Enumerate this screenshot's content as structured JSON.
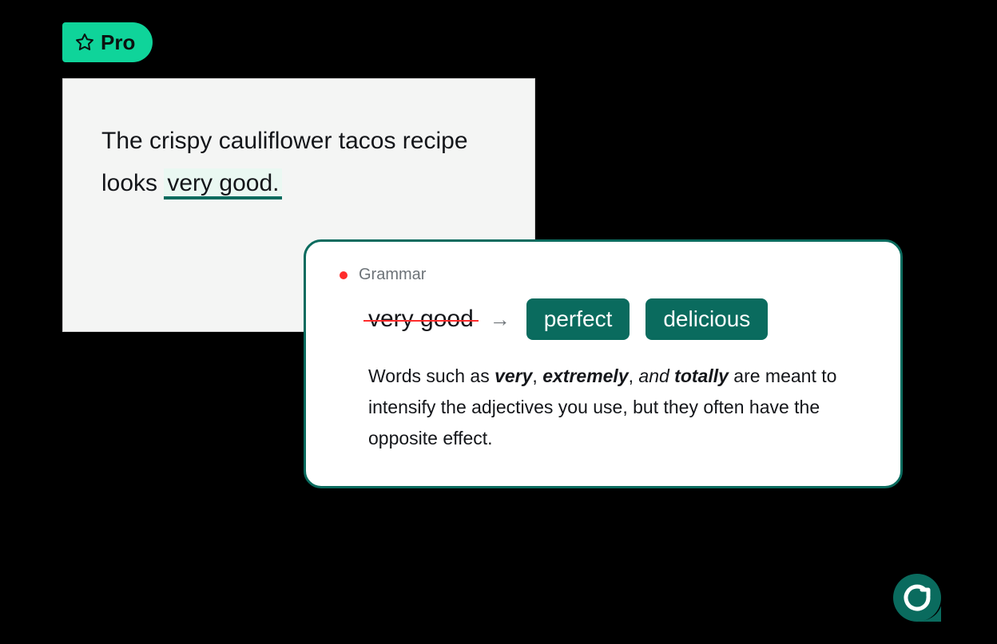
{
  "pro_badge": {
    "label": "Pro"
  },
  "text_card": {
    "prefix": "The crispy cauliflower tacos recipe looks ",
    "highlight": "very good."
  },
  "suggestion": {
    "category": "Grammar",
    "from": "very good",
    "options": [
      "perfect",
      "delicious"
    ],
    "desc_parts": {
      "t1": "Words such as ",
      "w1": "very",
      "c1": ", ",
      "w2": "extremely",
      "c2": ", ",
      "and_word": "and",
      "w3": "totally",
      "t2": " are meant to intensify the adjectives you use, but they often have the opposite effect."
    }
  }
}
